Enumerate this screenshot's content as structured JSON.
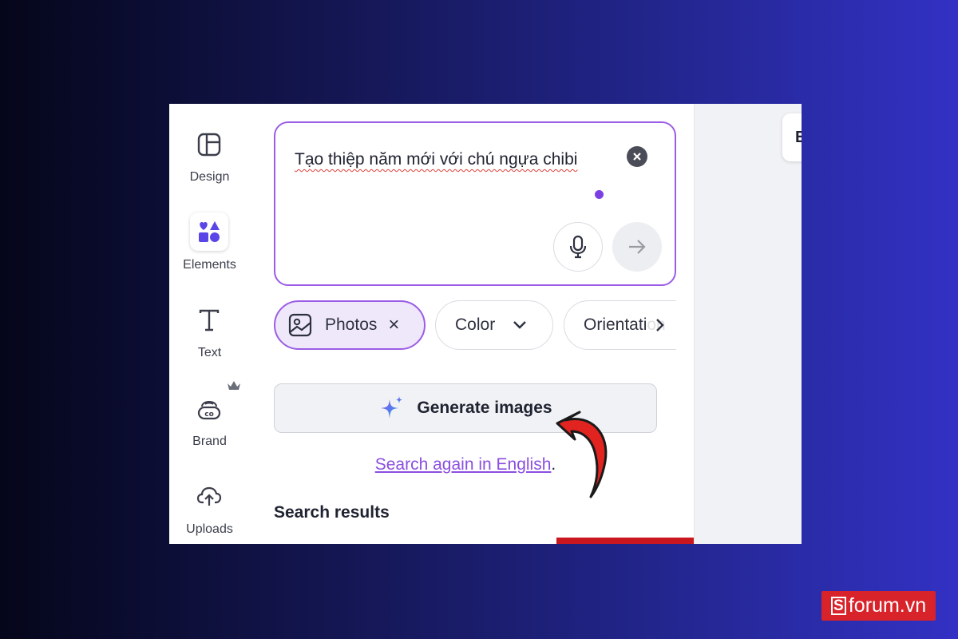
{
  "sidebar": {
    "items": [
      {
        "label": "Design",
        "icon": "layout-icon"
      },
      {
        "label": "Elements",
        "icon": "shapes-icon",
        "active": true
      },
      {
        "label": "Text",
        "icon": "text-icon"
      },
      {
        "label": "Brand",
        "icon": "brand-icon",
        "badge_icon": "crown-icon"
      },
      {
        "label": "Uploads",
        "icon": "cloud-upload-icon"
      }
    ]
  },
  "search": {
    "prompt": "Tạo thiệp năm mới  với chú ngựa chibi",
    "clear_icon": "close-circle-icon",
    "mic_icon": "microphone-icon",
    "send_icon": "arrow-right-icon"
  },
  "filters": {
    "chips": [
      {
        "label": "Photos",
        "icon": "image-icon",
        "trailing": "×",
        "active": true
      },
      {
        "label": "Color",
        "trailing_icon": "chevron-down-icon"
      },
      {
        "label": "Orientation"
      }
    ],
    "scroll_icon": "chevron-right-icon"
  },
  "generate": {
    "label": "Generate images",
    "icon": "sparkle-icon"
  },
  "search_again": {
    "link": "Search again in English",
    "suffix": "."
  },
  "results": {
    "title": "Search results"
  },
  "canvas": {
    "button_label": "E"
  },
  "branding": {
    "logo_text": "forum.vn",
    "logo_letter": "S"
  },
  "colors": {
    "accent": "#9b5de5",
    "link": "#8b4ee0",
    "annotation_arrow": "#e1241f",
    "logo_bg": "#d8232a"
  }
}
